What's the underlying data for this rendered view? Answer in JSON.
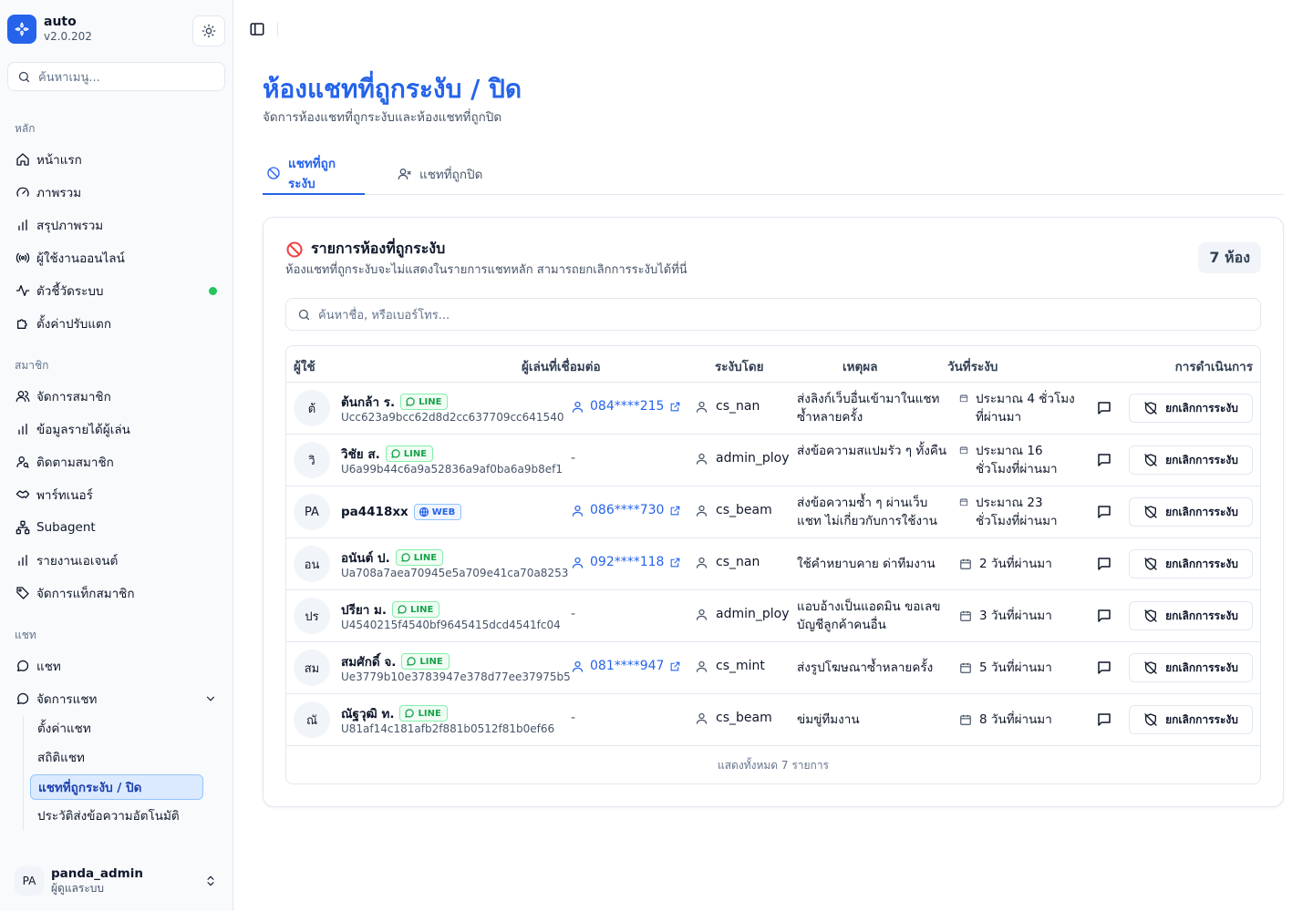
{
  "app": {
    "name": "auto",
    "version": "v2.0.202"
  },
  "sidebar": {
    "search_placeholder": "ค้นหาเมนู...",
    "groups": {
      "main": "หลัก",
      "members": "สมาชิก",
      "chat": "แชท"
    },
    "main_items": [
      {
        "label": "หน้าแรก",
        "icon": "home-icon"
      },
      {
        "label": "ภาพรวม",
        "icon": "gauge-icon"
      },
      {
        "label": "สรุปภาพรวม",
        "icon": "bar-chart-icon"
      },
      {
        "label": "ผู้ใช้งานออนไลน์",
        "icon": "radio-icon"
      },
      {
        "label": "ตัวชี้วัดระบบ",
        "icon": "activity-icon",
        "status_color": "#22c55e"
      },
      {
        "label": "ตั้งค่าปรับแตก",
        "icon": "puzzle-icon"
      }
    ],
    "member_items": [
      {
        "label": "จัดการสมาชิก",
        "icon": "users-icon"
      },
      {
        "label": "ข้อมูลรายได้ผู้เล่น",
        "icon": "bar-chart-icon"
      },
      {
        "label": "ติดตามสมาชิก",
        "icon": "user-search-icon"
      },
      {
        "label": "พาร์ทเนอร์",
        "icon": "handshake-icon"
      },
      {
        "label": "Subagent",
        "icon": "sitemap-icon"
      },
      {
        "label": "รายงานเอเจนต์",
        "icon": "bar-chart-icon"
      },
      {
        "label": "จัดการแท็กสมาชิก",
        "icon": "tag-icon"
      }
    ],
    "chat_items": [
      {
        "label": "แชท",
        "icon": "chat-icon"
      },
      {
        "label": "จัดการแชท",
        "icon": "chat-icon"
      }
    ],
    "chat_sub_items": [
      {
        "label": "ตั้งค่าแชท"
      },
      {
        "label": "สถิติแชท"
      },
      {
        "label": "แชทที่ถูกระงับ / ปิด",
        "active": true
      },
      {
        "label": "ประวัติส่งข้อความอัตโนมัติ"
      }
    ],
    "user": {
      "initials": "PA",
      "name": "panda_admin",
      "role": "ผู้ดูแลระบบ"
    }
  },
  "page": {
    "title": "ห้องแชทที่ถูกระงับ / ปิด",
    "subtitle": "จัดการห้องแชทที่ถูกระงับและห้องแชทที่ถูกปิด",
    "tabs": [
      {
        "label": "แชทที่ถูกระงับ",
        "icon": "ban-icon",
        "active": true
      },
      {
        "label": "แชทที่ถูกปิด",
        "icon": "user-x-icon",
        "active": false
      }
    ]
  },
  "card": {
    "title": "รายการห้องที่ถูกระงับ",
    "subtitle": "ห้องแชทที่ถูกระงับจะไม่แสดงในรายการแชทหลัก สามารถยกเลิกการระงับได้ที่นี่",
    "count": "7 ห้อง",
    "search_placeholder": "ค้นหาชื่อ, หรือเบอร์โทร...",
    "columns": [
      "ผู้ใช้",
      "ผู้เล่นที่เชื่อมต่อ",
      "ระงับโดย",
      "เหตุผล",
      "วันที่ระงับ",
      "การดำเนินการ"
    ],
    "action_label": "ยกเลิกการระงับ",
    "footer": "แสดงทั้งหมด 7 รายการ",
    "rows": [
      {
        "initials": "ต้",
        "name": "ต้นกล้า ร.",
        "channel": "LINE",
        "uid": "Ucc623a9bcc62d8d2cc637709cc641540",
        "phone": "084****215",
        "by": "cs_nan",
        "reason": "ส่งลิงก์เว็บอื่นเข้ามาในแชท ซ้ำหลายครั้ง",
        "date": "ประมาณ 4 ชั่วโมงที่ผ่านมา"
      },
      {
        "initials": "วิ",
        "name": "วิชัย ส.",
        "channel": "LINE",
        "uid": "U6a99b44c6a9a52836a9af0ba6a9b8ef1",
        "phone": "-",
        "by": "admin_ploy",
        "reason": "ส่งข้อความสแปมรัว ๆ ทั้งคืน",
        "date": "ประมาณ 16 ชั่วโมงที่ผ่านมา"
      },
      {
        "initials": "PA",
        "name": "pa4418xx",
        "channel": "WEB",
        "uid": "",
        "phone": "086****730",
        "by": "cs_beam",
        "reason": "ส่งข้อความซ้ำ ๆ ผ่านเว็บ แชท ไม่เกี่ยวกับการใช้งาน",
        "date": "ประมาณ 23 ชั่วโมงที่ผ่านมา"
      },
      {
        "initials": "อน",
        "name": "อนันต์ ป.",
        "channel": "LINE",
        "uid": "Ua708a7aea70945e5a709e41ca70a8253",
        "phone": "092****118",
        "by": "cs_nan",
        "reason": "ใช้คำหยาบคาย ด่าทีมงาน",
        "date": "2 วันที่ผ่านมา"
      },
      {
        "initials": "ปร",
        "name": "ปรียา ม.",
        "channel": "LINE",
        "uid": "U4540215f4540bf9645415dcd4541fc04",
        "phone": "-",
        "by": "admin_ploy",
        "reason": "แอบอ้างเป็นแอดมิน ขอเลข บัญชีลูกค้าคนอื่น",
        "date": "3 วันที่ผ่านมา"
      },
      {
        "initials": "สม",
        "name": "สมศักดิ์ จ.",
        "channel": "LINE",
        "uid": "Ue3779b10e3783947e378d77ee37975b5",
        "phone": "081****947",
        "by": "cs_mint",
        "reason": "ส่งรูปโฆษณาซ้ำหลายครั้ง",
        "date": "5 วันที่ผ่านมา"
      },
      {
        "initials": "ณั",
        "name": "ณัฐวุฒิ ท.",
        "channel": "LINE",
        "uid": "U81af14c181afb2f881b0512f81b0ef66",
        "phone": "-",
        "by": "cs_beam",
        "reason": "ข่มขู่ทีมงาน",
        "date": "8 วันที่ผ่านมา"
      }
    ]
  }
}
